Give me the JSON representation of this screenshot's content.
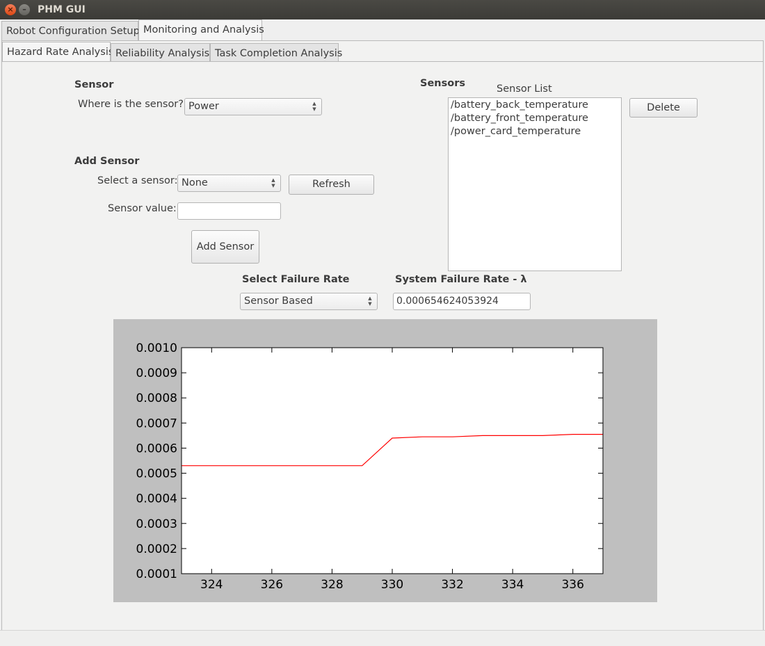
{
  "window": {
    "title": "PHM GUI",
    "close_glyph": "×",
    "minimize_glyph": "–"
  },
  "main_tabs": [
    {
      "label": "Robot Configuration Setup",
      "active": false
    },
    {
      "label": "Monitoring and Analysis",
      "active": true
    }
  ],
  "sub_tabs": [
    {
      "label": "Hazard Rate Analysis",
      "active": true
    },
    {
      "label": "Reliability Analysis",
      "active": false
    },
    {
      "label": "Task Completion Analysis",
      "active": false
    }
  ],
  "sensor": {
    "heading": "Sensor",
    "location_label": "Where is the sensor?",
    "location_value": "Power"
  },
  "add_sensor": {
    "heading": "Add Sensor",
    "select_label": "Select a sensor:",
    "select_value": "None",
    "refresh_label": "Refresh",
    "value_label": "Sensor value:",
    "value_input": "",
    "add_label": "Add Sensor"
  },
  "sensors": {
    "heading": "Sensors",
    "list_title": "Sensor List",
    "items": [
      "/battery_back_temperature",
      "/battery_front_temperature",
      "/power_card_temperature"
    ],
    "delete_label": "Delete"
  },
  "failure_rate": {
    "select_heading": "Select Failure Rate",
    "select_value": "Sensor Based",
    "system_heading": "System Failure Rate - λ",
    "system_value": "0.000654624053924"
  },
  "chart_data": {
    "type": "line",
    "title": "",
    "xlabel": "",
    "ylabel": "",
    "xlim": [
      323,
      337
    ],
    "ylim": [
      0.0001,
      0.001
    ],
    "xticks": [
      324,
      326,
      328,
      330,
      332,
      334,
      336
    ],
    "yticks": [
      "0.0001",
      "0.0002",
      "0.0003",
      "0.0004",
      "0.0005",
      "0.0006",
      "0.0007",
      "0.0008",
      "0.0009",
      "0.0010"
    ],
    "grid": false,
    "series": [
      {
        "color": "#ff0000",
        "x": [
          323,
          324,
          325,
          326,
          327,
          328,
          329,
          330,
          331,
          332,
          333,
          334,
          335,
          336,
          337
        ],
        "y": [
          0.00053,
          0.00053,
          0.00053,
          0.00053,
          0.00053,
          0.00053,
          0.00053,
          0.00064,
          0.000645,
          0.000645,
          0.00065,
          0.00065,
          0.00065,
          0.000655,
          0.000655
        ]
      }
    ]
  }
}
